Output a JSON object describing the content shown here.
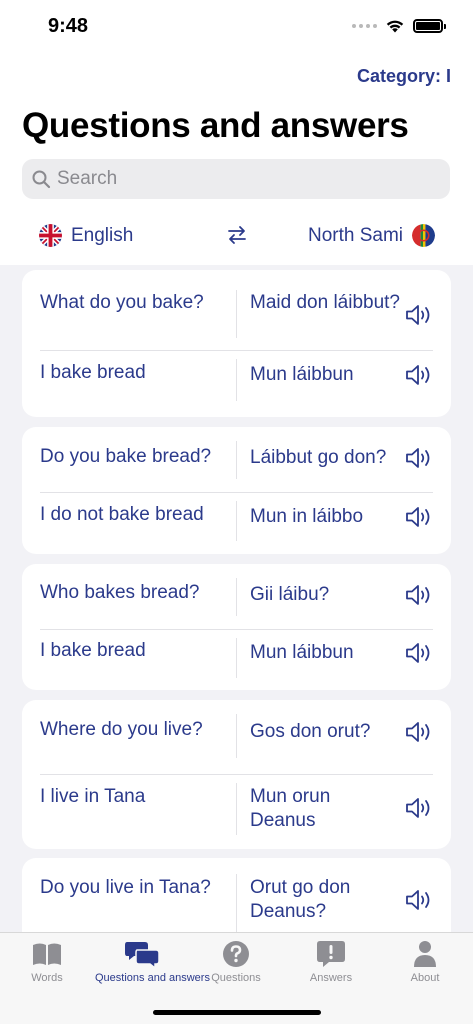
{
  "status": {
    "time": "9:48"
  },
  "header": {
    "category_link": "Category: I",
    "title": "Questions and answers"
  },
  "search": {
    "placeholder": "Search"
  },
  "languages": {
    "source": {
      "name": "English",
      "flag": "uk-flag-icon"
    },
    "swap_icon": "swap-arrows-icon",
    "target": {
      "name": "North Sami",
      "flag": "sami-flag-icon"
    }
  },
  "cards": [
    {
      "rows": [
        {
          "question": "What do you bake?",
          "answer": "Maid don láibbut?"
        },
        {
          "question": "I bake bread",
          "answer": "Mun láibbun"
        }
      ]
    },
    {
      "rows": [
        {
          "question": "Do you bake bread?",
          "answer": "Láibbut go don?"
        },
        {
          "question": "I do not bake bread",
          "answer": "Mun in láibbo"
        }
      ]
    },
    {
      "rows": [
        {
          "question": "Who bakes bread?",
          "answer": "Gii láibu?"
        },
        {
          "question": "I bake bread",
          "answer": "Mun láibbun"
        }
      ]
    },
    {
      "rows": [
        {
          "question": "Where do you live?",
          "answer": "Gos don orut?"
        },
        {
          "question": "I live in Tana",
          "answer": "Mun orun Deanus"
        }
      ]
    },
    {
      "rows": [
        {
          "question": "Do you live in Tana?",
          "answer": "Orut go don Deanus?"
        }
      ]
    }
  ],
  "tabs": [
    {
      "label": "Words",
      "icon": "book-icon",
      "active": false
    },
    {
      "label": "Questions and answers",
      "icon": "chat-bubbles-icon",
      "active": true
    },
    {
      "label": "Questions",
      "icon": "question-circle-icon",
      "active": false
    },
    {
      "label": "Answers",
      "icon": "exclamation-bubble-icon",
      "active": false
    },
    {
      "label": "About",
      "icon": "person-icon",
      "active": false
    }
  ],
  "colors": {
    "accent": "#2b3a8b",
    "inactive_tab": "#8e8e93",
    "list_background": "#f2f2f6"
  }
}
